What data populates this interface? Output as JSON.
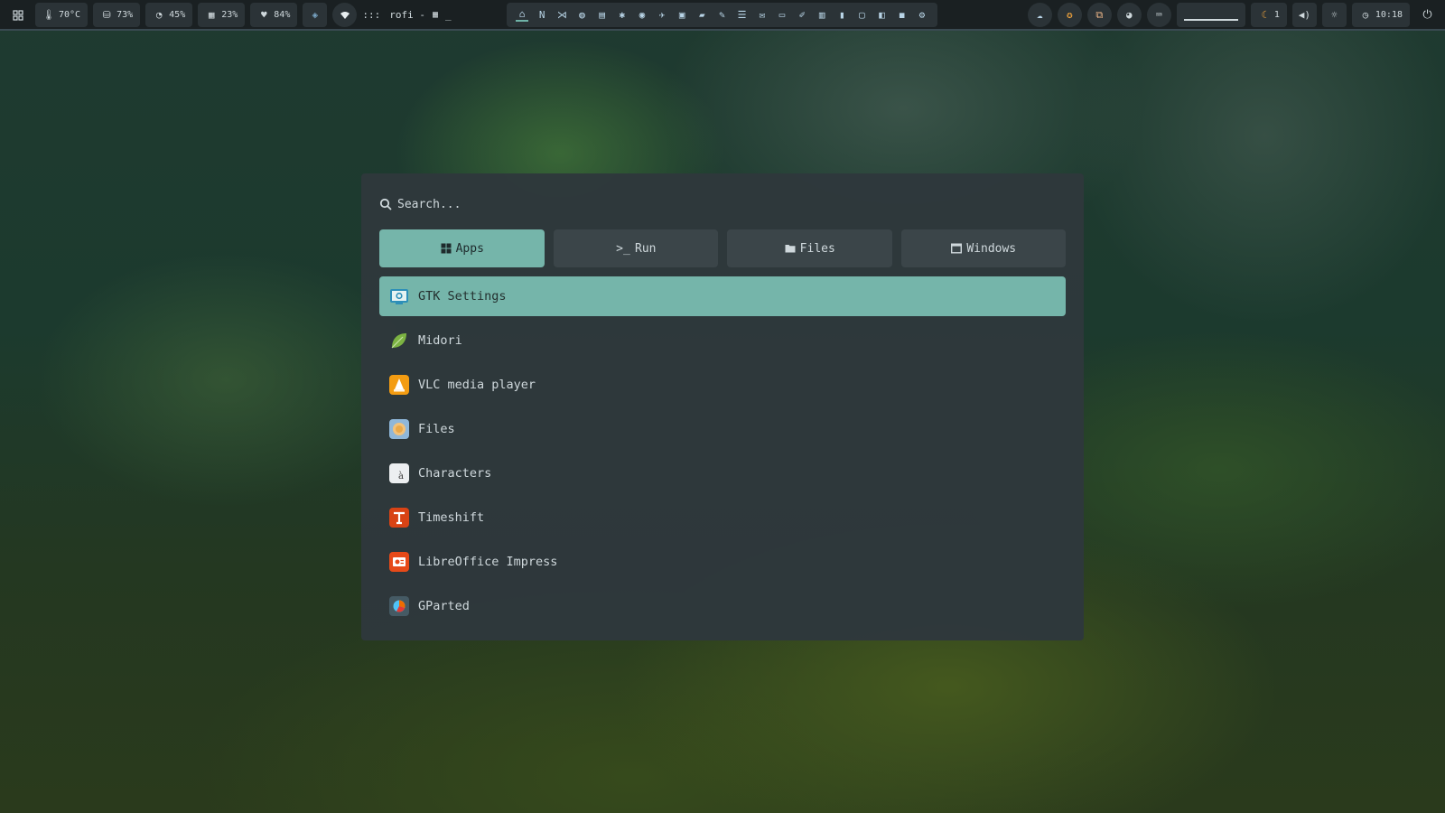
{
  "topbar": {
    "launcher_icon": "grid-icon",
    "temperature": "70°C",
    "disk": "73%",
    "cpu": "45%",
    "memory": "23%",
    "battery": "84%",
    "window_title": "rofi - ",
    "workspace_prefix": ":::",
    "dock_icons": [
      "home-icon",
      "neovim-icon",
      "vscode-icon",
      "browser-icon",
      "document-icon",
      "bug-icon",
      "github-icon",
      "bird-icon",
      "terminal-icon",
      "folder-icon",
      "edit-icon",
      "list-icon",
      "mail-icon",
      "video-icon",
      "draw-icon",
      "slides-icon",
      "chart-icon",
      "monitor-icon",
      "sidebar-icon",
      "record-icon",
      "settings-icon"
    ],
    "notifications_count": "1",
    "clock": "10:18",
    "accent": "#6fb3a8"
  },
  "rofi": {
    "search_placeholder": "Search...",
    "modes": [
      {
        "label": "Apps",
        "icon": "apps-grid-icon"
      },
      {
        "label": "Run",
        "icon": "terminal-prompt-icon"
      },
      {
        "label": "Files",
        "icon": "folder-icon"
      },
      {
        "label": "Windows",
        "icon": "window-icon"
      }
    ],
    "active_mode": "Apps",
    "items": [
      {
        "label": "GTK Settings",
        "icon": "gtk-settings-icon",
        "selected": true
      },
      {
        "label": "Midori",
        "icon": "midori-leaf-icon"
      },
      {
        "label": "VLC media player",
        "icon": "vlc-cone-icon"
      },
      {
        "label": "Files",
        "icon": "files-app-icon"
      },
      {
        "label": "Characters",
        "icon": "characters-app-icon"
      },
      {
        "label": "Timeshift",
        "icon": "timeshift-icon"
      },
      {
        "label": "LibreOffice Impress",
        "icon": "impress-icon"
      },
      {
        "label": "GParted",
        "icon": "gparted-icon"
      }
    ],
    "selection_color": "#75b5aa",
    "background_color": "#2e383c"
  }
}
